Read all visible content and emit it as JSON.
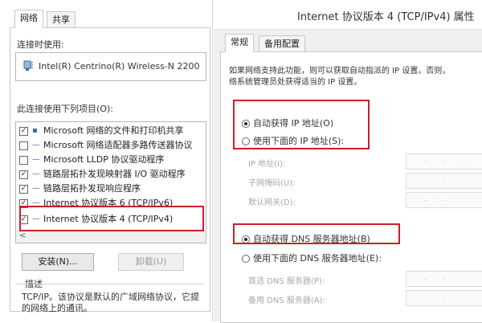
{
  "left": {
    "tabs": [
      {
        "label": "网络"
      },
      {
        "label": "共享"
      }
    ],
    "connect_using_label": "连接时使用:",
    "adapter_name": "Intel(R) Centrino(R) Wireless-N 2200",
    "items_label": "此连接使用下列项目(O):",
    "items": [
      {
        "label": "Microsoft 网络的文件和打印机共享",
        "checked": true
      },
      {
        "label": "Microsoft 网络适配器多路传送器协议",
        "checked": false
      },
      {
        "label": "Microsoft LLDP 协议驱动程序",
        "checked": false
      },
      {
        "label": "链路层拓扑发现映射器 I/O 驱动程序",
        "checked": true
      },
      {
        "label": "链路层拓扑发现响应程序",
        "checked": true
      },
      {
        "label": "Internet 协议版本 6 (TCP/IPv6)",
        "checked": true
      },
      {
        "label": "Internet 协议版本 4 (TCP/IPv4)",
        "checked": true
      }
    ],
    "install_button": "安装(N)...",
    "uninstall_button": "卸载(U)",
    "description_title": "描述",
    "description_text": "TCP/IP。该协议是默认的广域网络协议，它提",
    "description_text2": "的网络上的通讯。",
    "scroll_left": "<"
  },
  "right": {
    "title": "Internet 协议版本 4 (TCP/IPv4) 属性",
    "tabs": [
      {
        "label": "常规"
      },
      {
        "label": "备用配置"
      }
    ],
    "intro_line1": "如果网络支持此功能，则可以获取自动指派的 IP 设置。否则，",
    "intro_line2": "络系统管理员处获得适当的 IP 设置。",
    "auto_ip": "自动获得 IP 地址(O)",
    "manual_ip": "使用下面的 IP 地址(S):",
    "ip_address": "IP 地址(I):",
    "subnet_mask": "子网掩码(U):",
    "default_gateway": "默认网关(D):",
    "auto_dns": "自动获得 DNS 服务器地址(B)",
    "manual_dns": "使用下面的 DNS 服务器地址(E):",
    "preferred_dns": "首选 DNS 服务器(P):",
    "alternate_dns": "备用 DNS 服务器(A):",
    "auto_ip_selected": true,
    "auto_dns_selected": true
  },
  "colors": {
    "highlight": "#c8202a"
  }
}
